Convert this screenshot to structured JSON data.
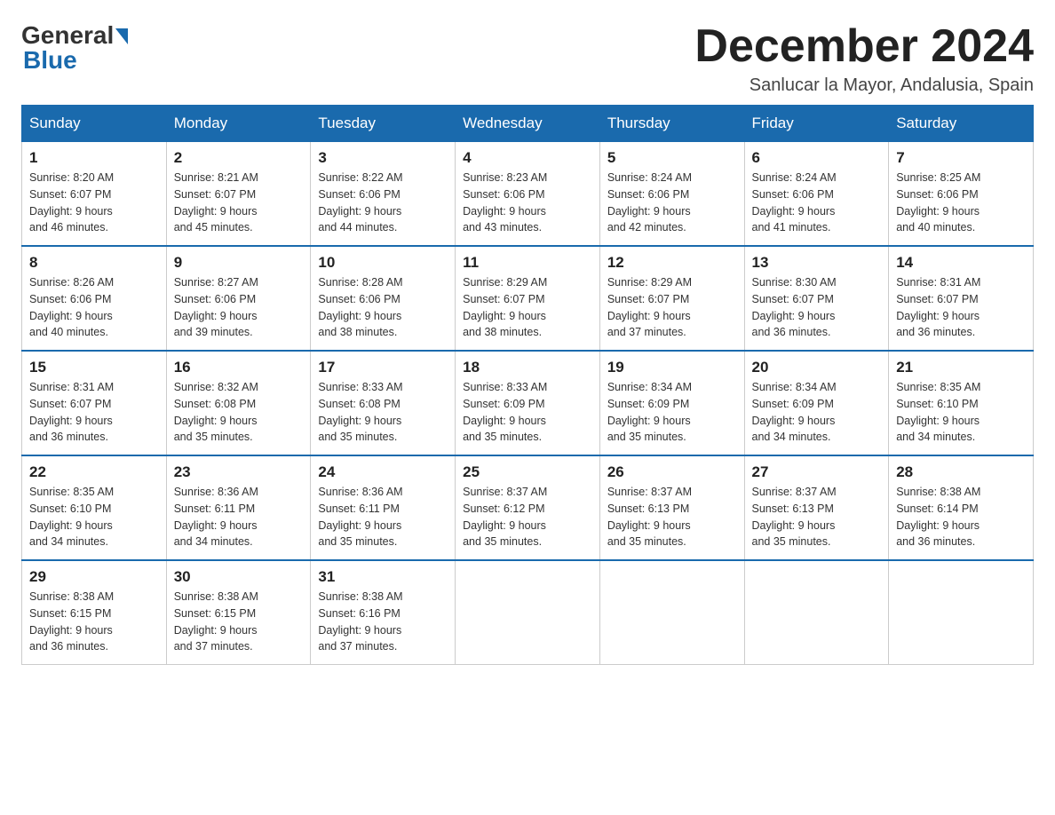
{
  "header": {
    "logo_general": "General",
    "logo_blue": "Blue",
    "month_title": "December 2024",
    "location": "Sanlucar la Mayor, Andalusia, Spain"
  },
  "days_of_week": [
    "Sunday",
    "Monday",
    "Tuesday",
    "Wednesday",
    "Thursday",
    "Friday",
    "Saturday"
  ],
  "weeks": [
    [
      {
        "day": "1",
        "sunrise": "8:20 AM",
        "sunset": "6:07 PM",
        "daylight": "9 hours and 46 minutes."
      },
      {
        "day": "2",
        "sunrise": "8:21 AM",
        "sunset": "6:07 PM",
        "daylight": "9 hours and 45 minutes."
      },
      {
        "day": "3",
        "sunrise": "8:22 AM",
        "sunset": "6:06 PM",
        "daylight": "9 hours and 44 minutes."
      },
      {
        "day": "4",
        "sunrise": "8:23 AM",
        "sunset": "6:06 PM",
        "daylight": "9 hours and 43 minutes."
      },
      {
        "day": "5",
        "sunrise": "8:24 AM",
        "sunset": "6:06 PM",
        "daylight": "9 hours and 42 minutes."
      },
      {
        "day": "6",
        "sunrise": "8:24 AM",
        "sunset": "6:06 PM",
        "daylight": "9 hours and 41 minutes."
      },
      {
        "day": "7",
        "sunrise": "8:25 AM",
        "sunset": "6:06 PM",
        "daylight": "9 hours and 40 minutes."
      }
    ],
    [
      {
        "day": "8",
        "sunrise": "8:26 AM",
        "sunset": "6:06 PM",
        "daylight": "9 hours and 40 minutes."
      },
      {
        "day": "9",
        "sunrise": "8:27 AM",
        "sunset": "6:06 PM",
        "daylight": "9 hours and 39 minutes."
      },
      {
        "day": "10",
        "sunrise": "8:28 AM",
        "sunset": "6:06 PM",
        "daylight": "9 hours and 38 minutes."
      },
      {
        "day": "11",
        "sunrise": "8:29 AM",
        "sunset": "6:07 PM",
        "daylight": "9 hours and 38 minutes."
      },
      {
        "day": "12",
        "sunrise": "8:29 AM",
        "sunset": "6:07 PM",
        "daylight": "9 hours and 37 minutes."
      },
      {
        "day": "13",
        "sunrise": "8:30 AM",
        "sunset": "6:07 PM",
        "daylight": "9 hours and 36 minutes."
      },
      {
        "day": "14",
        "sunrise": "8:31 AM",
        "sunset": "6:07 PM",
        "daylight": "9 hours and 36 minutes."
      }
    ],
    [
      {
        "day": "15",
        "sunrise": "8:31 AM",
        "sunset": "6:07 PM",
        "daylight": "9 hours and 36 minutes."
      },
      {
        "day": "16",
        "sunrise": "8:32 AM",
        "sunset": "6:08 PM",
        "daylight": "9 hours and 35 minutes."
      },
      {
        "day": "17",
        "sunrise": "8:33 AM",
        "sunset": "6:08 PM",
        "daylight": "9 hours and 35 minutes."
      },
      {
        "day": "18",
        "sunrise": "8:33 AM",
        "sunset": "6:09 PM",
        "daylight": "9 hours and 35 minutes."
      },
      {
        "day": "19",
        "sunrise": "8:34 AM",
        "sunset": "6:09 PM",
        "daylight": "9 hours and 35 minutes."
      },
      {
        "day": "20",
        "sunrise": "8:34 AM",
        "sunset": "6:09 PM",
        "daylight": "9 hours and 34 minutes."
      },
      {
        "day": "21",
        "sunrise": "8:35 AM",
        "sunset": "6:10 PM",
        "daylight": "9 hours and 34 minutes."
      }
    ],
    [
      {
        "day": "22",
        "sunrise": "8:35 AM",
        "sunset": "6:10 PM",
        "daylight": "9 hours and 34 minutes."
      },
      {
        "day": "23",
        "sunrise": "8:36 AM",
        "sunset": "6:11 PM",
        "daylight": "9 hours and 34 minutes."
      },
      {
        "day": "24",
        "sunrise": "8:36 AM",
        "sunset": "6:11 PM",
        "daylight": "9 hours and 35 minutes."
      },
      {
        "day": "25",
        "sunrise": "8:37 AM",
        "sunset": "6:12 PM",
        "daylight": "9 hours and 35 minutes."
      },
      {
        "day": "26",
        "sunrise": "8:37 AM",
        "sunset": "6:13 PM",
        "daylight": "9 hours and 35 minutes."
      },
      {
        "day": "27",
        "sunrise": "8:37 AM",
        "sunset": "6:13 PM",
        "daylight": "9 hours and 35 minutes."
      },
      {
        "day": "28",
        "sunrise": "8:38 AM",
        "sunset": "6:14 PM",
        "daylight": "9 hours and 36 minutes."
      }
    ],
    [
      {
        "day": "29",
        "sunrise": "8:38 AM",
        "sunset": "6:15 PM",
        "daylight": "9 hours and 36 minutes."
      },
      {
        "day": "30",
        "sunrise": "8:38 AM",
        "sunset": "6:15 PM",
        "daylight": "9 hours and 37 minutes."
      },
      {
        "day": "31",
        "sunrise": "8:38 AM",
        "sunset": "6:16 PM",
        "daylight": "9 hours and 37 minutes."
      },
      null,
      null,
      null,
      null
    ]
  ],
  "labels": {
    "sunrise_prefix": "Sunrise: ",
    "sunset_prefix": "Sunset: ",
    "daylight_prefix": "Daylight: "
  }
}
